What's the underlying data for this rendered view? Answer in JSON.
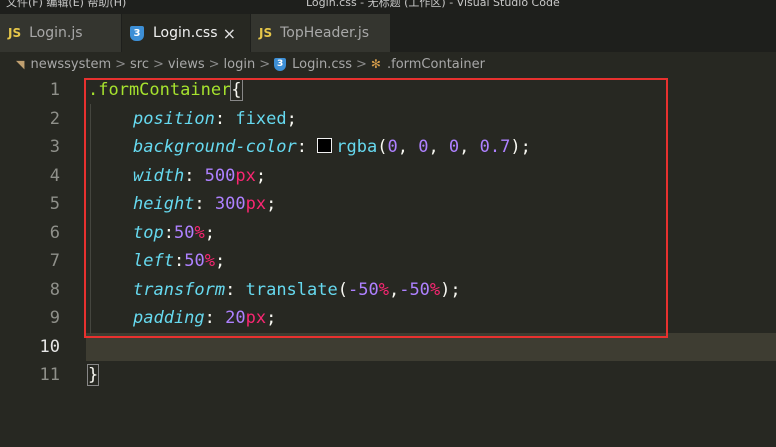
{
  "titlebar": {
    "menu_text": "文件(F)   编辑(E)   帮助(H)",
    "window_title": "Login.css - 无标题 (工作区) - Visual Studio Code"
  },
  "tabs": [
    {
      "label": "Login.js",
      "icon": "JS",
      "active": false
    },
    {
      "label": "Login.css",
      "icon": "css-icon",
      "active": true,
      "close": "×"
    },
    {
      "label": "TopHeader.js",
      "icon": "JS",
      "active": false
    }
  ],
  "breadcrumb": {
    "items": [
      "newssystem",
      "src",
      "views",
      "login",
      "Login.css",
      ".formContainer"
    ],
    "separator": ">"
  },
  "editor": {
    "line_numbers": [
      "1",
      "2",
      "3",
      "4",
      "5",
      "6",
      "7",
      "8",
      "9",
      "10",
      "11"
    ],
    "active_line": "10",
    "lines": {
      "l1": {
        "selector": ".formContainer",
        "brace": "{"
      },
      "l2": {
        "prop": "position",
        "colon": ": ",
        "value": "fixed",
        "semi": ";"
      },
      "l3": {
        "prop": "background-color",
        "colon": ": ",
        "fn": "rgba",
        "open": "(",
        "n1": "0",
        "c1": ", ",
        "n2": "0",
        "c2": ", ",
        "n3": "0",
        "c3": ", ",
        "n4": "0.7",
        "close": ")",
        "semi": ";"
      },
      "l4": {
        "prop": "width",
        "colon": ": ",
        "num": "500",
        "unit": "px",
        "semi": ";"
      },
      "l5": {
        "prop": "height",
        "colon": ": ",
        "num": "300",
        "unit": "px",
        "semi": ";"
      },
      "l6": {
        "prop": "top",
        "colon": ":",
        "num": "50",
        "unit": "%",
        "semi": ";"
      },
      "l7": {
        "prop": "left",
        "colon": ":",
        "num": "50",
        "unit": "%",
        "semi": ";"
      },
      "l8": {
        "prop": "transform",
        "colon": ": ",
        "fn": "translate",
        "open": "(",
        "n1": "-50",
        "u1": "%",
        "comma": ",",
        "n2": "-50",
        "u2": "%",
        "close": ")",
        "semi": ";"
      },
      "l9": {
        "prop": "padding",
        "colon": ": ",
        "num": "20",
        "unit": "px",
        "semi": ";"
      },
      "l11": {
        "brace": "}"
      }
    }
  },
  "colors": {
    "editor_bg": "#272822",
    "highlight_box": "#e8312f",
    "selector": "#a6e22e",
    "property": "#66d9ef",
    "number": "#ae81ff",
    "unit": "#f92672"
  }
}
